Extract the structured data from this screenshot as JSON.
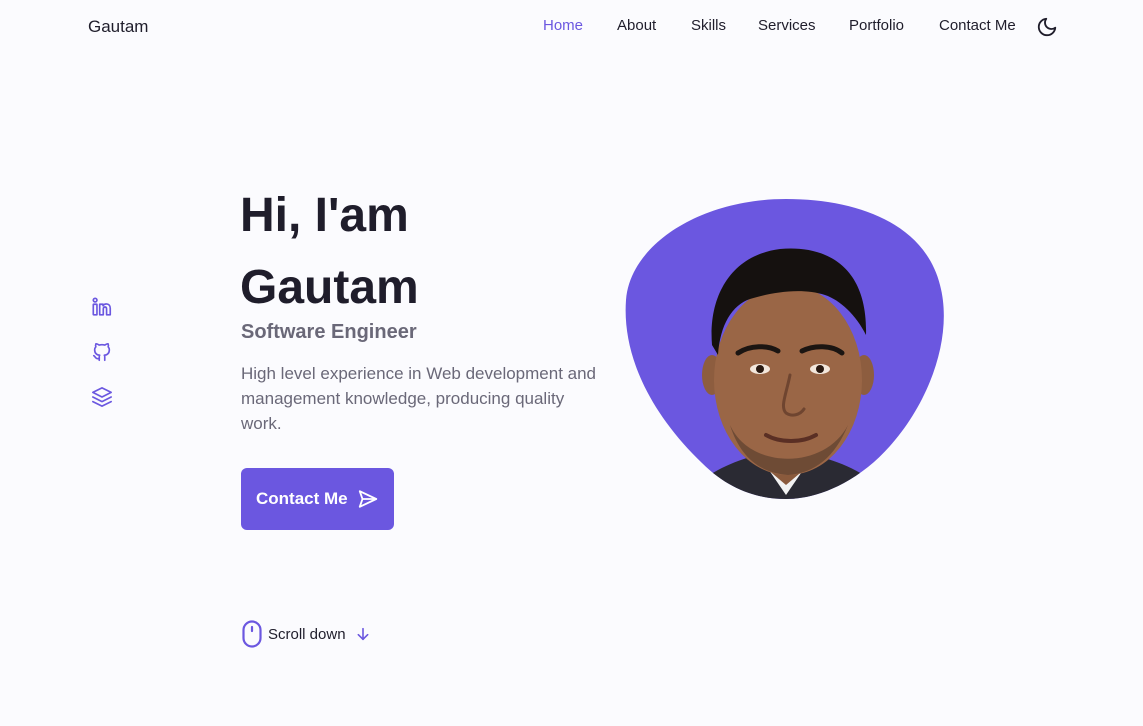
{
  "header": {
    "logo": "Gautam",
    "nav": [
      {
        "label": "Home",
        "active": true
      },
      {
        "label": "About",
        "active": false
      },
      {
        "label": "Skills",
        "active": false
      },
      {
        "label": "Services",
        "active": false
      },
      {
        "label": "Portfolio",
        "active": false
      },
      {
        "label": "Contact Me",
        "active": false
      }
    ],
    "theme_toggle_icon": "moon-icon"
  },
  "social": [
    {
      "icon": "linkedin-icon"
    },
    {
      "icon": "github-icon"
    },
    {
      "icon": "layers-icon"
    }
  ],
  "hero": {
    "greeting_line1": "Hi, I'am",
    "greeting_line2": "Gautam",
    "subtitle": "Software Engineer",
    "description": "High level experience in Web development and management knowledge, producing quality work.",
    "cta_label": "Contact Me",
    "cta_icon": "send-icon",
    "profile_photo_icon": "profile-photo"
  },
  "scroll": {
    "label": "Scroll down",
    "icon": "mouse-icon",
    "arrow_icon": "arrow-down-icon"
  },
  "colors": {
    "accent": "#6b57e0",
    "background": "#fbfbfe",
    "text": "#1f1d2b",
    "muted": "#6a6878"
  }
}
